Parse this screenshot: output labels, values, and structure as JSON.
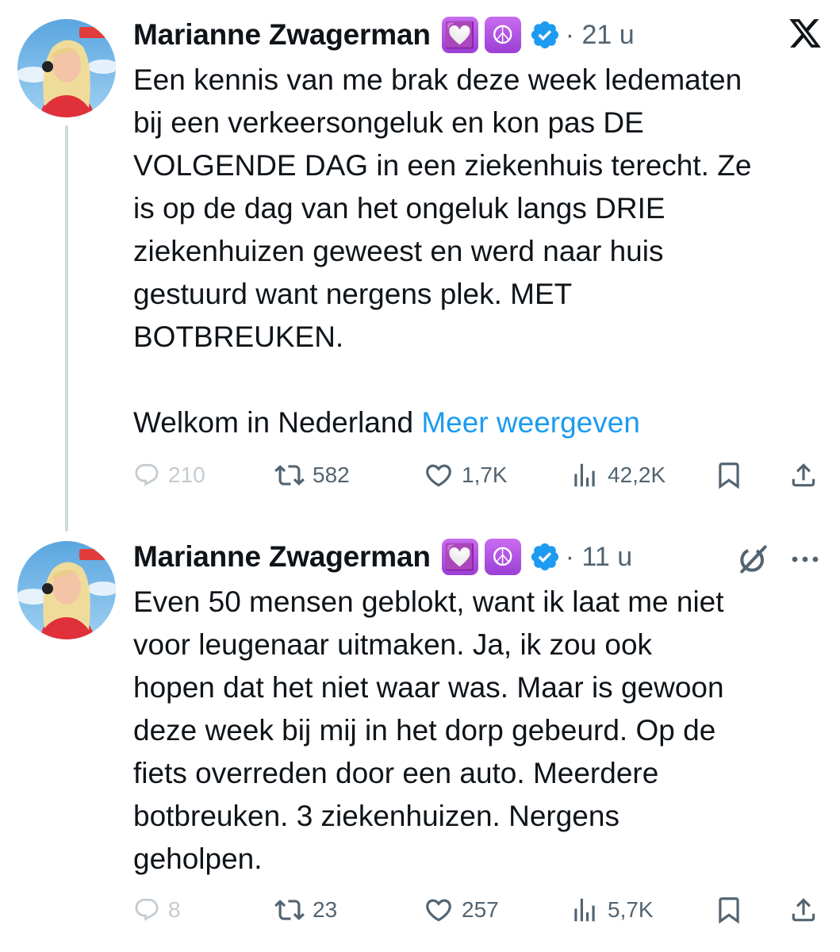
{
  "colors": {
    "accent": "#1d9bf0",
    "text": "#0f1419",
    "muted": "#536471",
    "thread_line": "#cfd9de",
    "emoji_purple": "#a855f7"
  },
  "tweets": [
    {
      "author": "Marianne Zwagerman",
      "emoji_badges": [
        "💟",
        "☮"
      ],
      "verified_icon": "verified-badge-icon",
      "time": "· 21 u",
      "corner_icon": "x-logo-icon",
      "text_lines": [
        "Een kennis van me brak deze week ledematen",
        "bij een verkeersongeluk en kon pas DE",
        "VOLGENDE DAG in een ziekenhuis terecht. Ze",
        "is op de dag van het ongeluk langs DRIE",
        "ziekenhuizen geweest en werd naar huis",
        "gestuurd want nergens plek. MET",
        "BOTBREUKEN."
      ],
      "closing_text": "Welkom in Nederland",
      "more_link": "Meer weergeven",
      "stats": {
        "replies": "210",
        "reposts": "582",
        "likes": "1,7K",
        "views": "42,2K"
      }
    },
    {
      "author": "Marianne Zwagerman",
      "emoji_badges": [
        "💟",
        "☮"
      ],
      "verified_icon": "verified-badge-icon",
      "time": "· 11 u",
      "corner_icons": [
        "grok-icon",
        "more-dots-icon"
      ],
      "text_lines": [
        "Even 50 mensen geblokt, want ik laat me niet",
        "voor leugenaar uitmaken. Ja, ik zou ook",
        "hopen dat het niet waar was. Maar is gewoon",
        "deze week bij mij in het dorp gebeurd. Op de",
        "fiets overreden door een auto. Meerdere",
        "botbreuken. 3 ziekenhuizen. Nergens",
        "geholpen."
      ],
      "stats": {
        "replies": "8",
        "reposts": "23",
        "likes": "257",
        "views": "5,7K"
      }
    }
  ]
}
